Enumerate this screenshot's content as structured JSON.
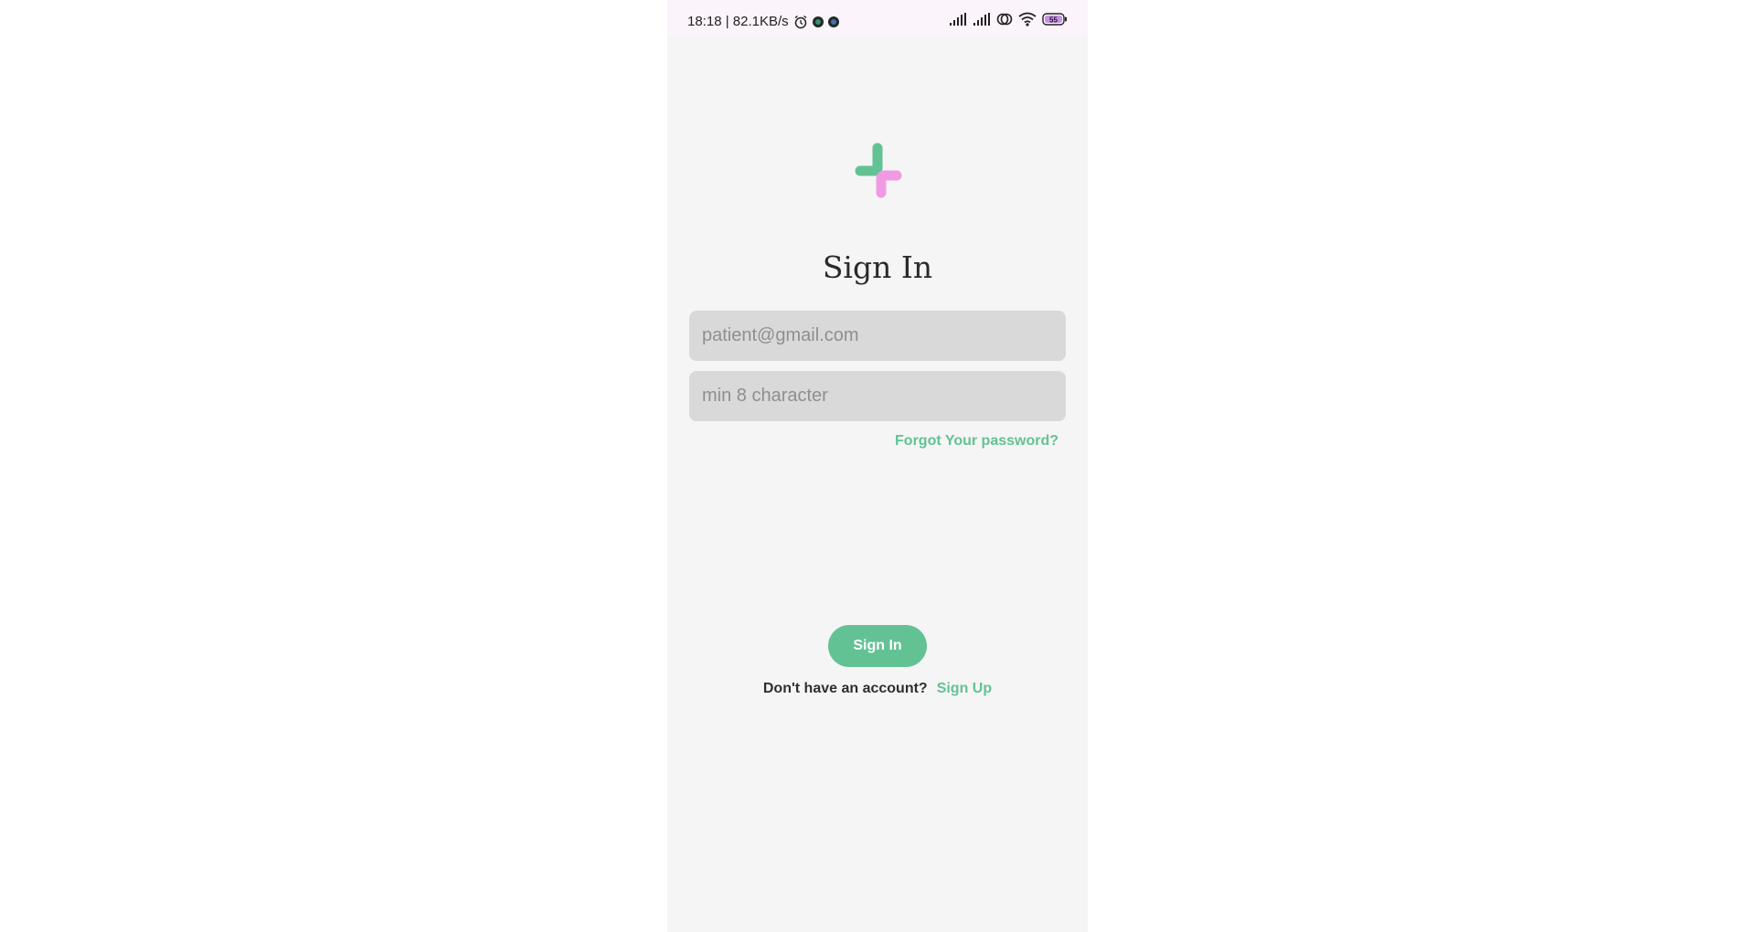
{
  "status_bar": {
    "time_speed": "18:18 | 82.1KB/s",
    "icons": [
      "alarm-icon",
      "app-notification-icon",
      "app-notification-icon",
      "signal-icon",
      "signal-icon",
      "hotspot-icon",
      "wifi-icon",
      "battery-icon"
    ],
    "battery_level": "55"
  },
  "logo": {
    "icon": "plus-logo-icon",
    "colors": {
      "green": "#63c294",
      "pink": "#f19ae3"
    }
  },
  "title": "Sign In",
  "form": {
    "email_placeholder": "patient@gmail.com",
    "email_value": "",
    "password_placeholder": "min 8 character",
    "password_value": ""
  },
  "forgot_password_label": "Forgot Your password?",
  "sign_in_button_label": "Sign In",
  "signup_prompt": "Don't have an account?",
  "signup_link_label": "Sign Up",
  "colors": {
    "accent": "#63c294",
    "background": "#f5f5f5",
    "field_background": "#d9d9d9"
  }
}
